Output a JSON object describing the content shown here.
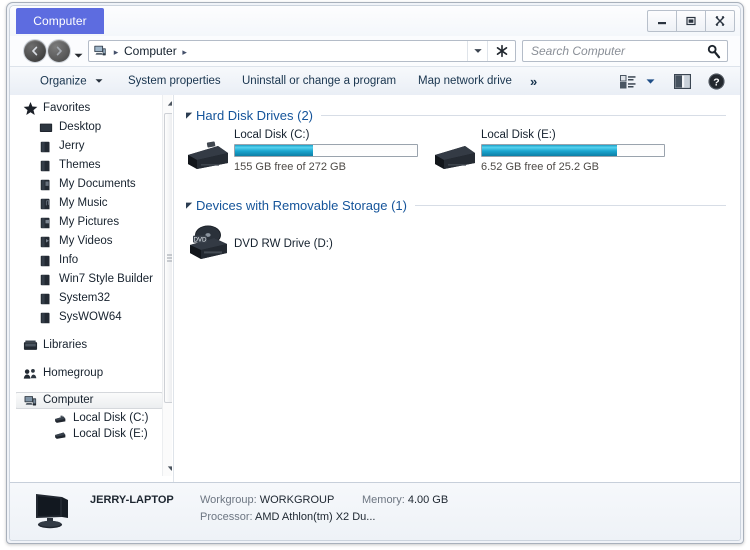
{
  "window": {
    "tab_title": "Computer",
    "accent_color": "#5d6ce0",
    "buttons": {
      "minimize": "minimize",
      "maximize": "maximize",
      "close": "close"
    }
  },
  "address_bar": {
    "back": "Back",
    "forward": "Forward",
    "recent_pages": "Recent pages",
    "crumb_root_icon": "computer-icon",
    "crumbs": [
      "Computer"
    ],
    "dropdown": "Previous locations",
    "refresh": "Refresh"
  },
  "search": {
    "placeholder": "Search Computer",
    "icon": "search-icon"
  },
  "toolbar": {
    "items": [
      {
        "label": "Organize",
        "caret": true
      },
      {
        "label": "System properties",
        "caret": false
      },
      {
        "label": "Uninstall or change a program",
        "caret": false
      },
      {
        "label": "Map network drive",
        "caret": false
      },
      {
        "label": "»",
        "caret": false
      }
    ],
    "right_icons": [
      "view-options-icon",
      "chevron-down-icon",
      "preview-pane-icon",
      "help-icon"
    ]
  },
  "sidebar": {
    "groups": [
      {
        "label": "Favorites",
        "icon": "star-icon",
        "items": [
          {
            "label": "Desktop",
            "icon": "desktop-icon"
          },
          {
            "label": "Jerry",
            "icon": "folder-icon"
          },
          {
            "label": "Themes",
            "icon": "folder-icon"
          },
          {
            "label": "My Documents",
            "icon": "folder-icon"
          },
          {
            "label": "My Music",
            "icon": "folder-icon"
          },
          {
            "label": "My Pictures",
            "icon": "folder-icon"
          },
          {
            "label": "My Videos",
            "icon": "folder-icon"
          },
          {
            "label": "Info",
            "icon": "folder-icon"
          },
          {
            "label": "Win7 Style Builder",
            "icon": "folder-icon"
          },
          {
            "label": "System32",
            "icon": "folder-icon"
          },
          {
            "label": "SysWOW64",
            "icon": "folder-icon"
          }
        ]
      },
      {
        "label": "Libraries",
        "icon": "libraries-icon",
        "items": []
      },
      {
        "label": "Homegroup",
        "icon": "homegroup-icon",
        "items": []
      },
      {
        "label": "Computer",
        "icon": "computer-icon",
        "selected": true,
        "items": [
          {
            "label": "Local Disk (C:)",
            "icon": "drive-icon"
          },
          {
            "label": "Local Disk (E:)",
            "icon": "drive-icon"
          }
        ]
      }
    ],
    "scrollbar": {
      "up_arrow": "scroll-up-arrow",
      "down_arrow": "scroll-down-arrow",
      "thumb": "scroll-thumb"
    }
  },
  "content": {
    "groups": [
      {
        "title": "Hard Disk Drives (2)",
        "collapse_icon": "triangle-down-icon",
        "items": [
          {
            "name": "Local Disk (C:)",
            "icon": "hard-drive-icon",
            "sub": "155 GB free of 272 GB",
            "used_percent": 43,
            "meter_color": "#1aa5cf",
            "has_meter": true
          },
          {
            "name": "Local Disk (E:)",
            "icon": "hard-drive-icon",
            "sub": "6.52 GB free of 25.2 GB",
            "used_percent": 74,
            "meter_color": "#1aa5cf",
            "has_meter": true
          }
        ]
      },
      {
        "title": "Devices with Removable Storage (1)",
        "collapse_icon": "triangle-down-icon",
        "items": [
          {
            "name": "DVD RW Drive (D:)",
            "icon": "dvd-drive-icon",
            "sub": "",
            "has_meter": false
          }
        ]
      }
    ]
  },
  "details": {
    "icon": "computer-icon",
    "computer_name": "JERRY-LAPTOP",
    "workgroup_label": "Workgroup:",
    "workgroup_value": "WORKGROUP",
    "memory_label": "Memory:",
    "memory_value": "4.00 GB",
    "processor_label": "Processor:",
    "processor_value": "AMD Athlon(tm) X2 Du..."
  }
}
